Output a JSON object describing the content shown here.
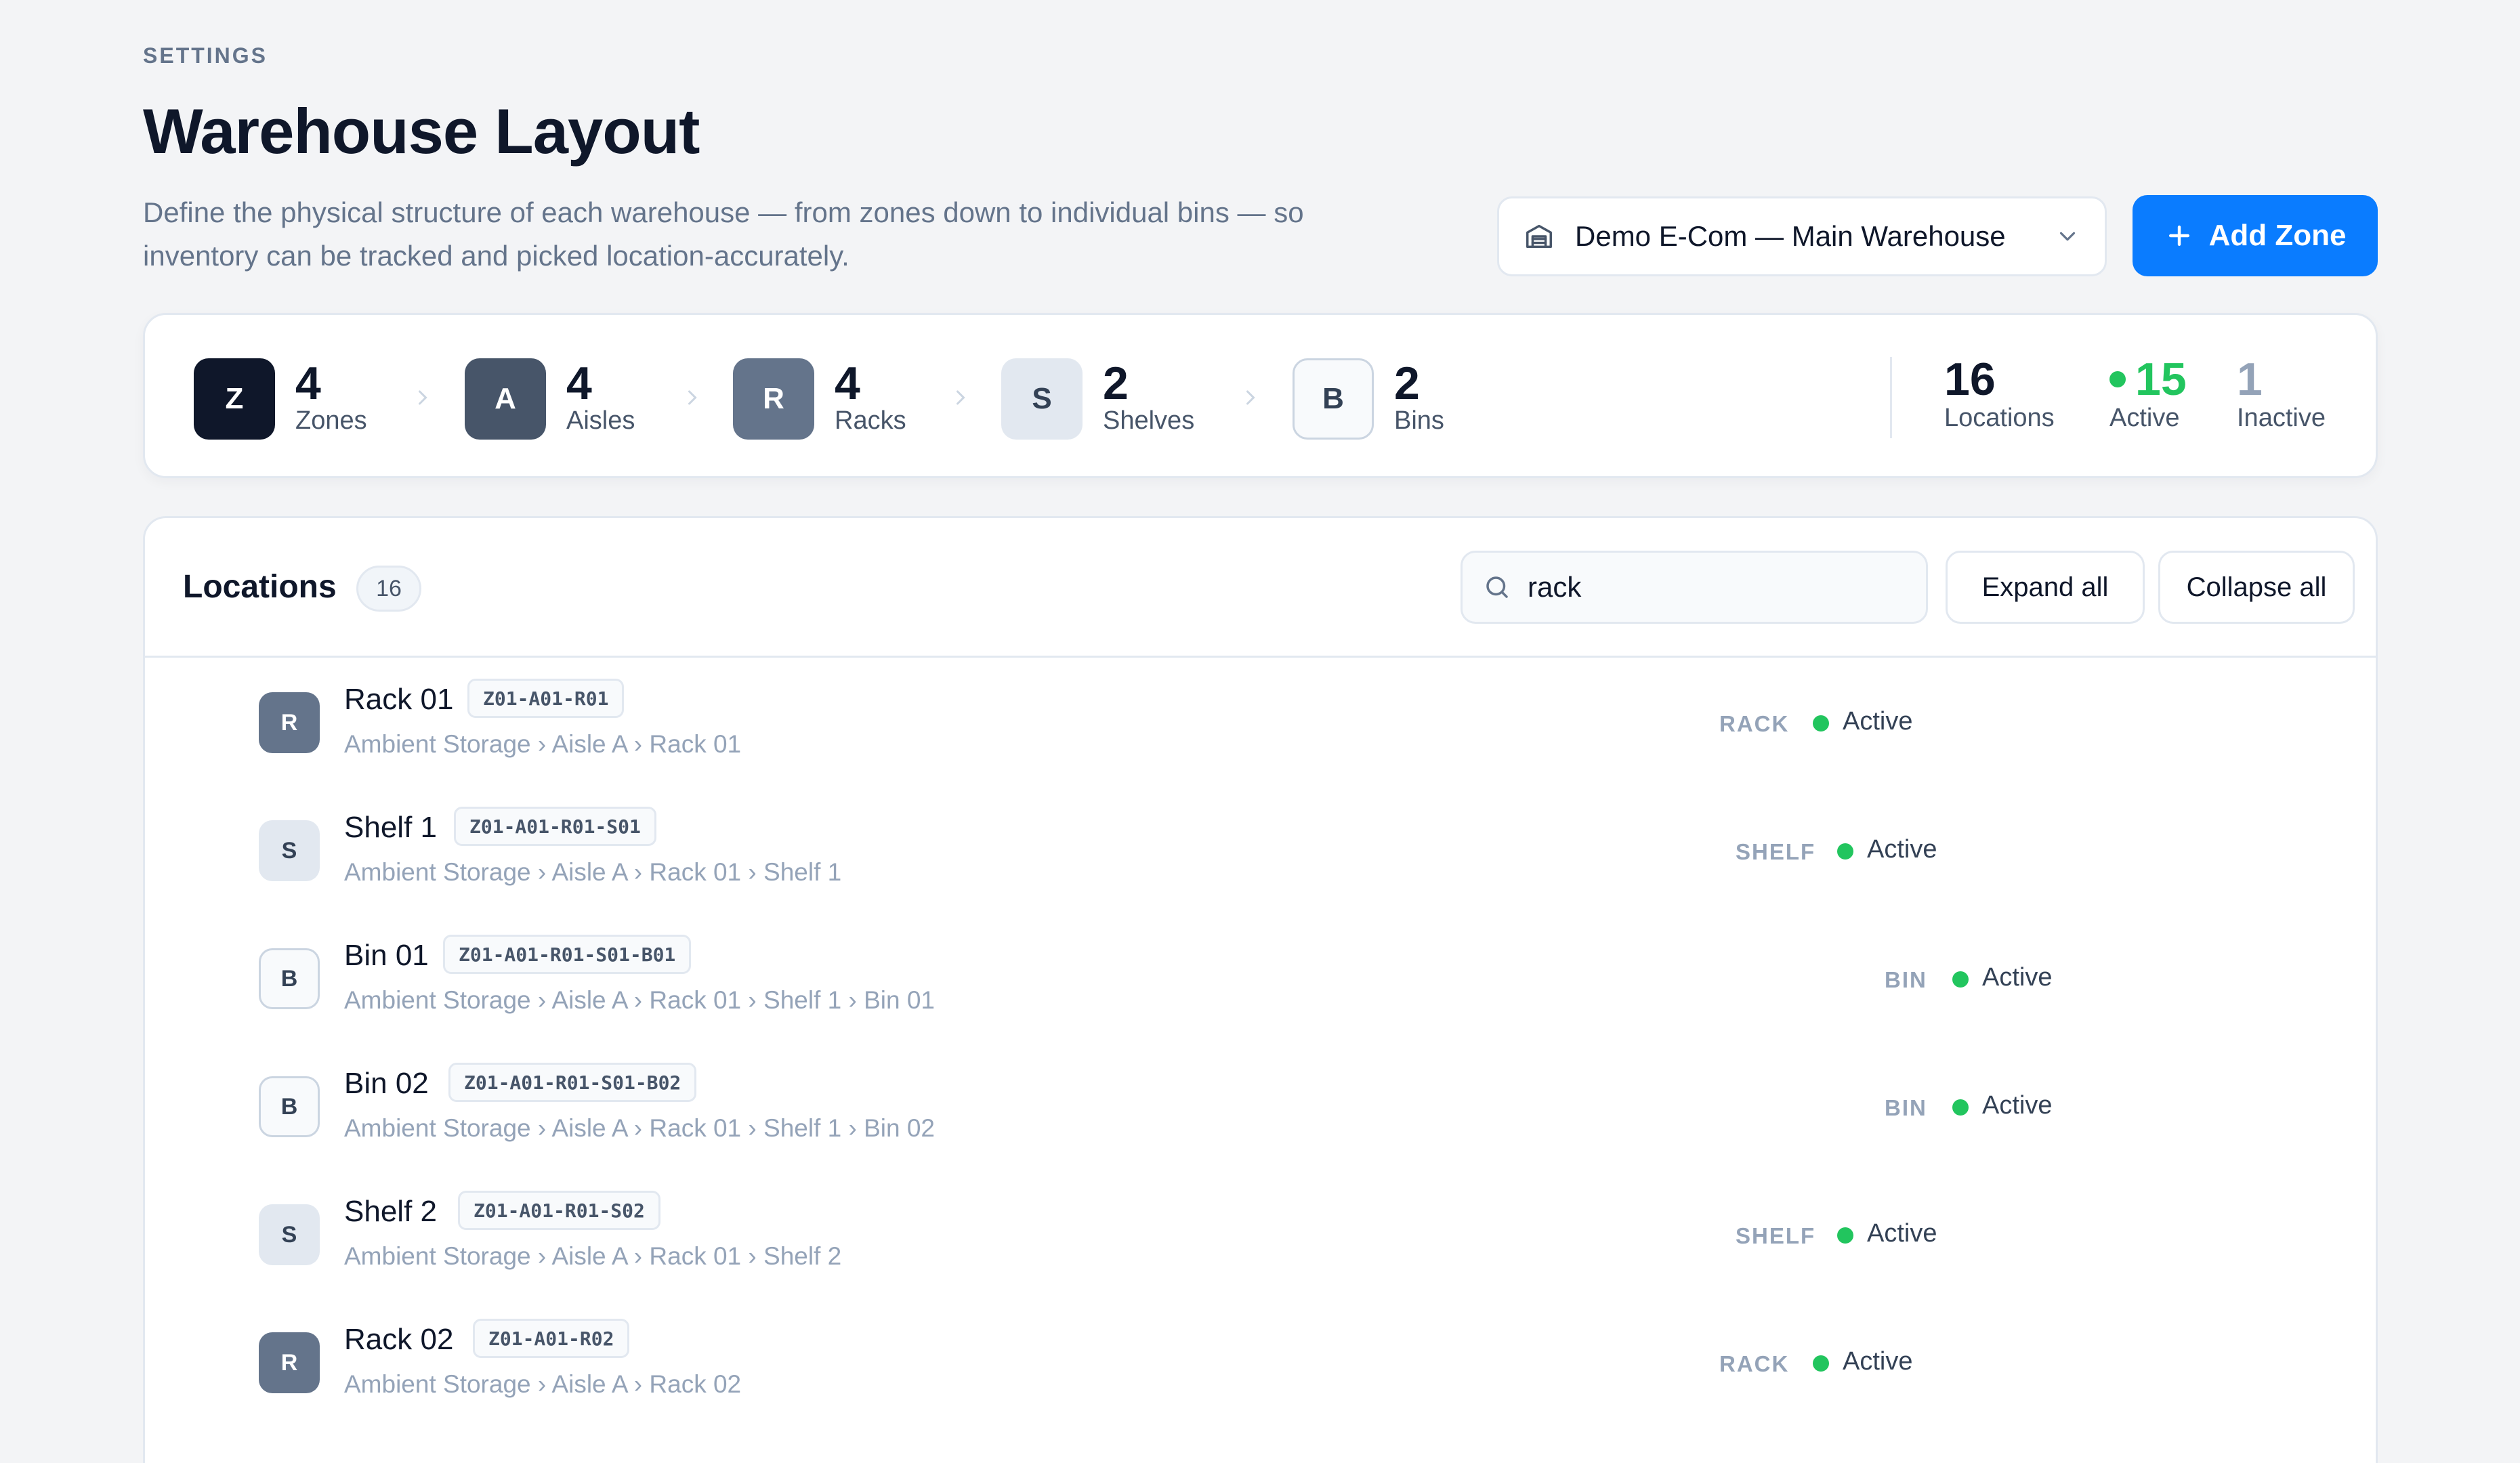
{
  "header": {
    "eyebrow": "SETTINGS",
    "title": "Warehouse Layout",
    "subtitle": "Define the physical structure of each warehouse — from zones down to individual bins — so inventory can be tracked and picked location-accurately."
  },
  "warehouse_select": {
    "value": "Demo E-Com — Main Warehouse"
  },
  "add_zone_button": {
    "label": "Add Zone"
  },
  "hierarchy": [
    {
      "letter": "Z",
      "count": "4",
      "name": "Zones"
    },
    {
      "letter": "A",
      "count": "4",
      "name": "Aisles"
    },
    {
      "letter": "R",
      "count": "4",
      "name": "Racks"
    },
    {
      "letter": "S",
      "count": "2",
      "name": "Shelves"
    },
    {
      "letter": "B",
      "count": "2",
      "name": "Bins"
    }
  ],
  "totals": {
    "locations": {
      "value": "16",
      "label": "Locations"
    },
    "active": {
      "value": "15",
      "label": "Active"
    },
    "inactive": {
      "value": "1",
      "label": "Inactive"
    }
  },
  "locations": {
    "title": "Locations",
    "count": "16",
    "search_value": "rack",
    "expand_label": "Expand all",
    "collapse_label": "Collapse all",
    "rows": [
      {
        "letter": "R",
        "name": "Rack 01",
        "code": "Z01-A01-R01",
        "path": "Ambient Storage › Aisle A › Rack 01",
        "type": "RACK",
        "status": "Active"
      },
      {
        "letter": "S",
        "name": "Shelf 1",
        "code": "Z01-A01-R01-S01",
        "path": "Ambient Storage › Aisle A › Rack 01 › Shelf 1",
        "type": "SHELF",
        "status": "Active"
      },
      {
        "letter": "B",
        "name": "Bin 01",
        "code": "Z01-A01-R01-S01-B01",
        "path": "Ambient Storage › Aisle A › Rack 01 › Shelf 1 › Bin 01",
        "type": "BIN",
        "status": "Active"
      },
      {
        "letter": "B",
        "name": "Bin 02",
        "code": "Z01-A01-R01-S01-B02",
        "path": "Ambient Storage › Aisle A › Rack 01 › Shelf 1 › Bin 02",
        "type": "BIN",
        "status": "Active"
      },
      {
        "letter": "S",
        "name": "Shelf 2",
        "code": "Z01-A01-R01-S02",
        "path": "Ambient Storage › Aisle A › Rack 01 › Shelf 2",
        "type": "SHELF",
        "status": "Active"
      },
      {
        "letter": "R",
        "name": "Rack 02",
        "code": "Z01-A01-R02",
        "path": "Ambient Storage › Aisle A › Rack 02",
        "type": "RACK",
        "status": "Active"
      }
    ]
  },
  "colors": {
    "accent": "#0a7cff",
    "active_green": "#22c55e",
    "inactive_gray": "#94a3b8"
  }
}
